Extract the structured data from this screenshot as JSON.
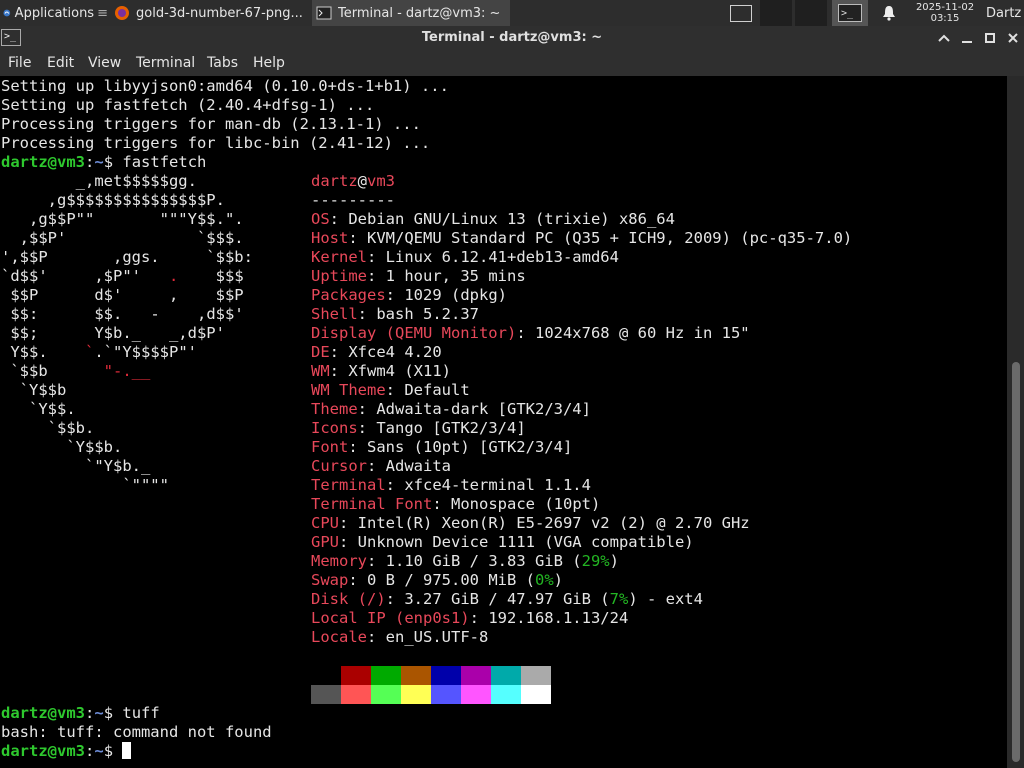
{
  "panel": {
    "applications_label": "Applications",
    "tasks": [
      {
        "label": "gold-3d-number-67-png..."
      },
      {
        "label": "Terminal - dartz@vm3: ~"
      }
    ],
    "clock_date": "2025-11-02",
    "clock_time": "03:15",
    "user": "Dartz"
  },
  "window": {
    "title": "Terminal - dartz@vm3: ~"
  },
  "menu": [
    "File",
    "Edit",
    "View",
    "Terminal",
    "Tabs",
    "Help"
  ],
  "terminal": {
    "prompt_user": "dartz@vm3",
    "prompt_path": "~",
    "prompt_symbol": "$",
    "output_before": [
      "Setting up libyyjson0:amd64 (0.10.0+ds-1+b1) ...",
      "Setting up fastfetch (2.40.4+dfsg-1) ...",
      "Processing triggers for man-db (2.13.1-1) ...",
      "Processing triggers for libc-bin (2.41-12) ..."
    ],
    "command1": "fastfetch",
    "logo_lines": [
      "        _,met$$$$$gg.",
      "     ,g$$$$$$$$$$$$$$$P.",
      "   ,g$$P\"\"       \"\"\"Y$$.\".",
      "  ,$$P'              `$$$.",
      "',$$P       ,ggs.     `$$b:",
      "`d$$'     ,$P\"'   .    $$$",
      " $$P      d$'     ,    $$P",
      " $$:      $$.   -    ,d$$'",
      " $$;      Y$b._   _,d$P'",
      " Y$$.    `.`\"Y$$$$P\"'",
      " `$$b      \"-.__",
      "  `Y$$b",
      "   `Y$$.",
      "     `$$b.",
      "       `Y$$b.",
      "         `\"Y$b._",
      "             `\"\"\"\""
    ],
    "header_user": "dartz",
    "header_at": "@",
    "header_host": "vm3",
    "separator": "---------",
    "info": [
      {
        "label": "OS",
        "value": "Debian GNU/Linux 13 (trixie) x86_64"
      },
      {
        "label": "Host",
        "value": "KVM/QEMU Standard PC (Q35 + ICH9, 2009) (pc-q35-7.0)"
      },
      {
        "label": "Kernel",
        "value": "Linux 6.12.41+deb13-amd64"
      },
      {
        "label": "Uptime",
        "value": "1 hour, 35 mins"
      },
      {
        "label": "Packages",
        "value": "1029 (dpkg)"
      },
      {
        "label": "Shell",
        "value": "bash 5.2.37"
      },
      {
        "label": "Display (QEMU Monitor)",
        "value": "1024x768 @ 60 Hz in 15\""
      },
      {
        "label": "DE",
        "value": "Xfce4 4.20"
      },
      {
        "label": "WM",
        "value": "Xfwm4 (X11)"
      },
      {
        "label": "WM Theme",
        "value": "Default"
      },
      {
        "label": "Theme",
        "value": "Adwaita-dark [GTK2/3/4]"
      },
      {
        "label": "Icons",
        "value": "Tango [GTK2/3/4]"
      },
      {
        "label": "Font",
        "value": "Sans (10pt) [GTK2/3/4]"
      },
      {
        "label": "Cursor",
        "value": "Adwaita"
      },
      {
        "label": "Terminal",
        "value": "xfce4-terminal 1.1.4"
      },
      {
        "label": "Terminal Font",
        "value": "Monospace (10pt)"
      },
      {
        "label": "CPU",
        "value": "Intel(R) Xeon(R) E5-2697 v2 (2) @ 2.70 GHz"
      },
      {
        "label": "GPU",
        "value": "Unknown Device 1111 (VGA compatible)"
      },
      {
        "label": "Memory",
        "value": "1.10 GiB / 3.83 GiB (",
        "pct": "29%",
        "tail": ")"
      },
      {
        "label": "Swap",
        "value": "0 B / 975.00 MiB (",
        "pct": "0%",
        "tail": ")"
      },
      {
        "label": "Disk (/)",
        "value": "3.27 GiB / 47.97 GiB (",
        "pct": "7%",
        "tail": ") - ext4"
      },
      {
        "label": "Local IP (enp0s1)",
        "value": "192.168.1.13/24"
      },
      {
        "label": "Locale",
        "value": "en_US.UTF-8"
      }
    ],
    "colors_row1": [
      "#000000",
      "#aa0000",
      "#00aa00",
      "#aa5500",
      "#0000aa",
      "#aa00aa",
      "#00aaaa",
      "#aaaaaa"
    ],
    "colors_row2": [
      "#555555",
      "#ff5555",
      "#55ff55",
      "#ffff55",
      "#5555ff",
      "#ff55ff",
      "#55ffff",
      "#ffffff"
    ],
    "command2": "tuff",
    "error_line": "bash: tuff: command not found"
  }
}
